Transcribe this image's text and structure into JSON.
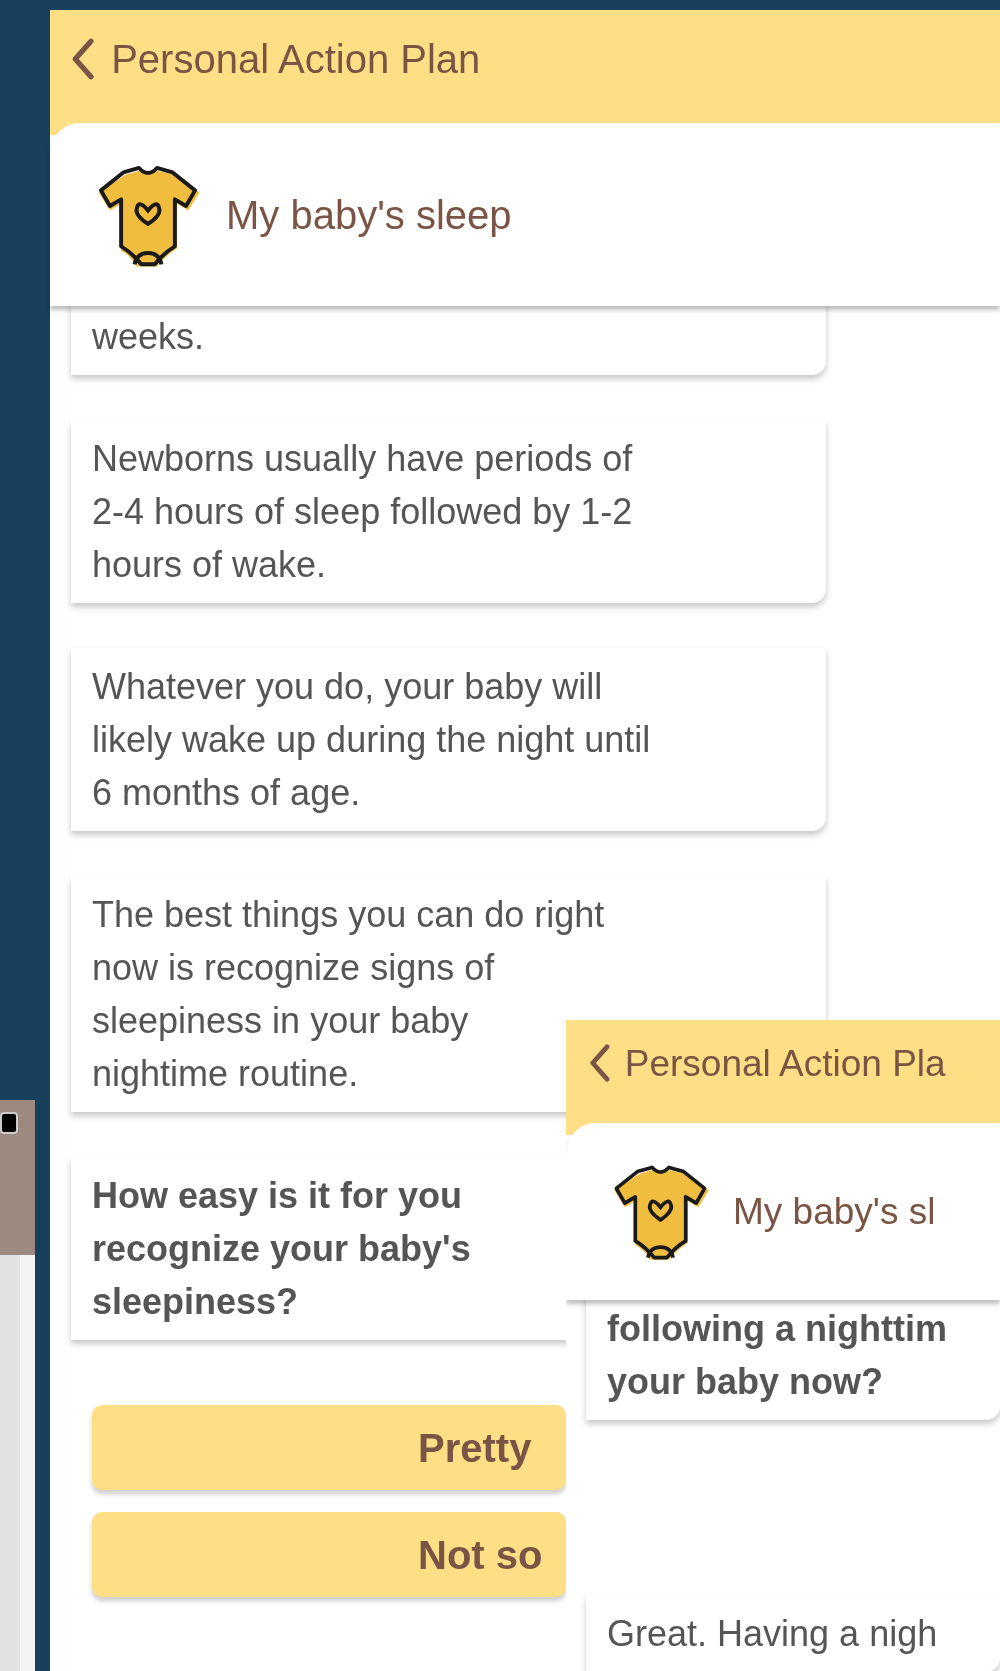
{
  "main_screen": {
    "header": {
      "title": "Personal Action Plan"
    },
    "topic": {
      "title": "My baby's sleep"
    },
    "messages": [
      {
        "kind": "info",
        "lines": [
          "weeks."
        ]
      },
      {
        "kind": "info",
        "lines": [
          "Newborns usually have periods of",
          "2-4 hours of sleep followed by 1-2",
          "hours of wake."
        ]
      },
      {
        "kind": "info",
        "lines": [
          "Whatever you do, your baby will",
          "likely wake up during the night until",
          "6 months of age."
        ]
      },
      {
        "kind": "info",
        "lines": [
          "The best things you can do right",
          "now is recognize signs of",
          "sleepiness in your baby",
          "nightime routine."
        ]
      },
      {
        "kind": "question",
        "lines": [
          "How easy is it for you",
          "recognize your baby's",
          "sleepiness?"
        ]
      }
    ],
    "answers": [
      {
        "label": "Pretty"
      },
      {
        "label": "Not so"
      }
    ]
  },
  "overlay_screen": {
    "header": {
      "title": "Personal Action Pla"
    },
    "topic": {
      "title": "My baby's sl"
    },
    "messages": [
      {
        "kind": "question",
        "lines": [
          "following a nighttim",
          "your baby now?"
        ]
      },
      {
        "kind": "info",
        "lines": [
          "Great. Having a nigh"
        ]
      }
    ]
  }
}
